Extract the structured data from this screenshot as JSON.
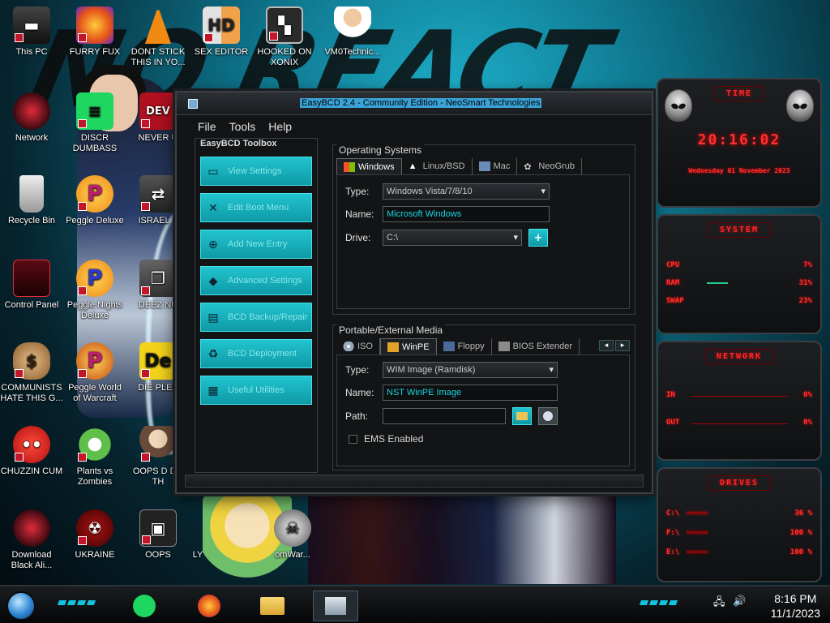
{
  "desktop": {
    "icons": [
      {
        "label": "This PC"
      },
      {
        "label": "FURRY FUX"
      },
      {
        "label": "DONT STICK THIS IN YO..."
      },
      {
        "label": "SEX EDITOR"
      },
      {
        "label": "HOOKED ON XONIX"
      },
      {
        "label": "VM0Technic..."
      },
      {
        "label": "Network"
      },
      {
        "label": "DISCR DUMBASS"
      },
      {
        "label": "NEVER U"
      },
      {
        "label": "Recycle Bin"
      },
      {
        "label": "Peggle Deluxe"
      },
      {
        "label": "ISRAEL S"
      },
      {
        "label": "Control Panel"
      },
      {
        "label": "Peggle Nights Deluxe"
      },
      {
        "label": "DEEZ NU"
      },
      {
        "label": "COMMUNISTS HATE THIS G..."
      },
      {
        "label": "Peggle World of Warcraft"
      },
      {
        "label": "DIE PLEA"
      },
      {
        "label": "CHUZZIN CUM"
      },
      {
        "label": "Plants vs Zombies"
      },
      {
        "label": "OOPS D DO TH"
      },
      {
        "label": "Download Black Ali..."
      },
      {
        "label": "UKRAINE"
      },
      {
        "label": "OOPS"
      },
      {
        "label": "LY"
      },
      {
        "label": "omWar..."
      }
    ]
  },
  "window": {
    "title": "EasyBCD 2.4 - Community Edition - NeoSmart Technologies",
    "menu": [
      "File",
      "Tools",
      "Help"
    ],
    "toolbox": {
      "header": "EasyBCD Toolbox",
      "buttons": [
        {
          "label": "View Settings",
          "icon": "monitor-icon"
        },
        {
          "label": "Edit Boot Menu",
          "icon": "tools-icon"
        },
        {
          "label": "Add New Entry",
          "icon": "add-entry-icon"
        },
        {
          "label": "Advanced Settings",
          "icon": "advanced-icon"
        },
        {
          "label": "BCD Backup/Repair",
          "icon": "backup-icon"
        },
        {
          "label": "BCD Deployment",
          "icon": "deployment-icon"
        },
        {
          "label": "Useful Utilities",
          "icon": "utilities-icon"
        }
      ]
    },
    "os": {
      "legend": "Operating Systems",
      "tabs": [
        "Windows",
        "Linux/BSD",
        "Mac",
        "NeoGrub"
      ],
      "type_label": "Type:",
      "type_value": "Windows Vista/7/8/10",
      "name_label": "Name:",
      "name_value": "Microsoft Windows",
      "drive_label": "Drive:",
      "drive_value": "C:\\",
      "add_glyph": "+"
    },
    "portable": {
      "legend": "Portable/External Media",
      "tabs": [
        "ISO",
        "WinPE",
        "Floppy",
        "BIOS Extender"
      ],
      "nav_prev": "◂",
      "nav_next": "▸",
      "type_label": "Type:",
      "type_value": "WIM Image (Ramdisk)",
      "name_label": "Name:",
      "name_value": "NST WinPE Image",
      "path_label": "Path:",
      "path_value": "",
      "ems_label": "EMS Enabled",
      "ems_checked": false
    }
  },
  "gadgets": {
    "time": {
      "header": "TIME",
      "time": "20:16:02",
      "date": "Wednesday 01 November 2023"
    },
    "system": {
      "header": "SYSTEM",
      "rows": [
        {
          "k": "CPU",
          "v": "7%"
        },
        {
          "k": "RAM",
          "v": "31%"
        },
        {
          "k": "SWAP",
          "v": "23%"
        }
      ]
    },
    "network": {
      "header": "NETWORK",
      "rows": [
        {
          "k": "IN",
          "v": "0%"
        },
        {
          "k": "OUT",
          "v": "0%"
        }
      ]
    },
    "drives": {
      "header": "DRIVES",
      "rows": [
        {
          "k": "C:\\",
          "v": "36 %"
        },
        {
          "k": "F:\\",
          "v": "100 %"
        },
        {
          "k": "E:\\",
          "v": "100 %"
        }
      ]
    }
  },
  "taskbar": {
    "clock_time": "8:16 PM",
    "clock_date": "11/1/2023"
  }
}
